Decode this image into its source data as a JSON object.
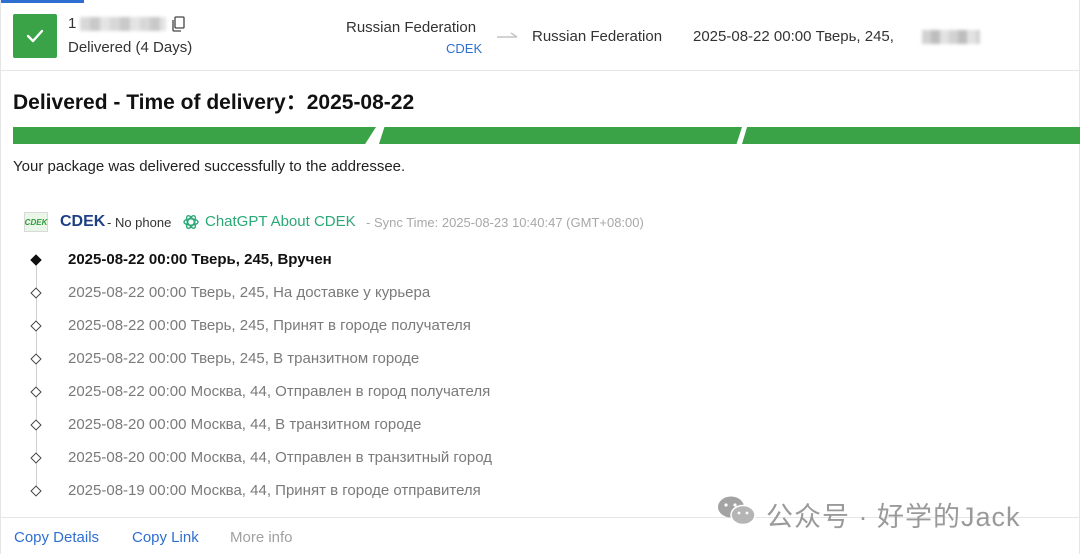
{
  "header": {
    "tracking_number": "1",
    "status_label": "Delivered (4 Days)",
    "origin_country": "Russian Federation",
    "carrier_link": "CDEK",
    "destination_country": "Russian Federation",
    "latest_event": "2025-08-22 00:00  Тверь, 245,"
  },
  "title": "Delivered - Time of delivery：2025-08-22",
  "progress": {
    "filled_segments": 3,
    "total_segments": 3,
    "color": "#3aa347"
  },
  "delivered_message": "Your package was delivered successfully to the addressee.",
  "carrier": {
    "logo_text": "CDEK",
    "name": "CDEK",
    "phone": "- No phone",
    "chatgpt_link": "ChatGPT About CDEK",
    "sync_time": "- Sync Time: 2025-08-23 10:40:47 (GMT+08:00)"
  },
  "events": [
    {
      "text": "2025-08-22 00:00  Тверь, 245, Вручен",
      "current": true
    },
    {
      "text": "2025-08-22 00:00  Тверь, 245, На доставке у курьера",
      "current": false
    },
    {
      "text": "2025-08-22 00:00  Тверь, 245, Принят в городе получателя",
      "current": false
    },
    {
      "text": "2025-08-22 00:00  Тверь, 245, В транзитном городе",
      "current": false
    },
    {
      "text": "2025-08-22 00:00  Москва, 44, Отправлен в город получателя",
      "current": false
    },
    {
      "text": "2025-08-20 00:00  Москва, 44, В транзитном городе",
      "current": false
    },
    {
      "text": "2025-08-20 00:00  Москва, 44, Отправлен в транзитный город",
      "current": false
    },
    {
      "text": "2025-08-19 00:00  Москва, 44, Принят в городе отправителя",
      "current": false
    }
  ],
  "footer": {
    "copy_details": "Copy Details",
    "copy_link": "Copy Link",
    "more_info": "More info"
  },
  "watermark": "公众号 · 好学的Jack",
  "icons": {
    "status": "check-icon",
    "copy": "copy-icon",
    "route": "arrow-right-icon",
    "chatgpt": "chatgpt-icon",
    "watermark": "wechat-icon",
    "timeline": "diamond-icon"
  },
  "colors": {
    "accent": "#2f6fd1",
    "success": "#3aa347",
    "carrier_name": "#1f3f86",
    "chatgpt": "#2aa876"
  }
}
